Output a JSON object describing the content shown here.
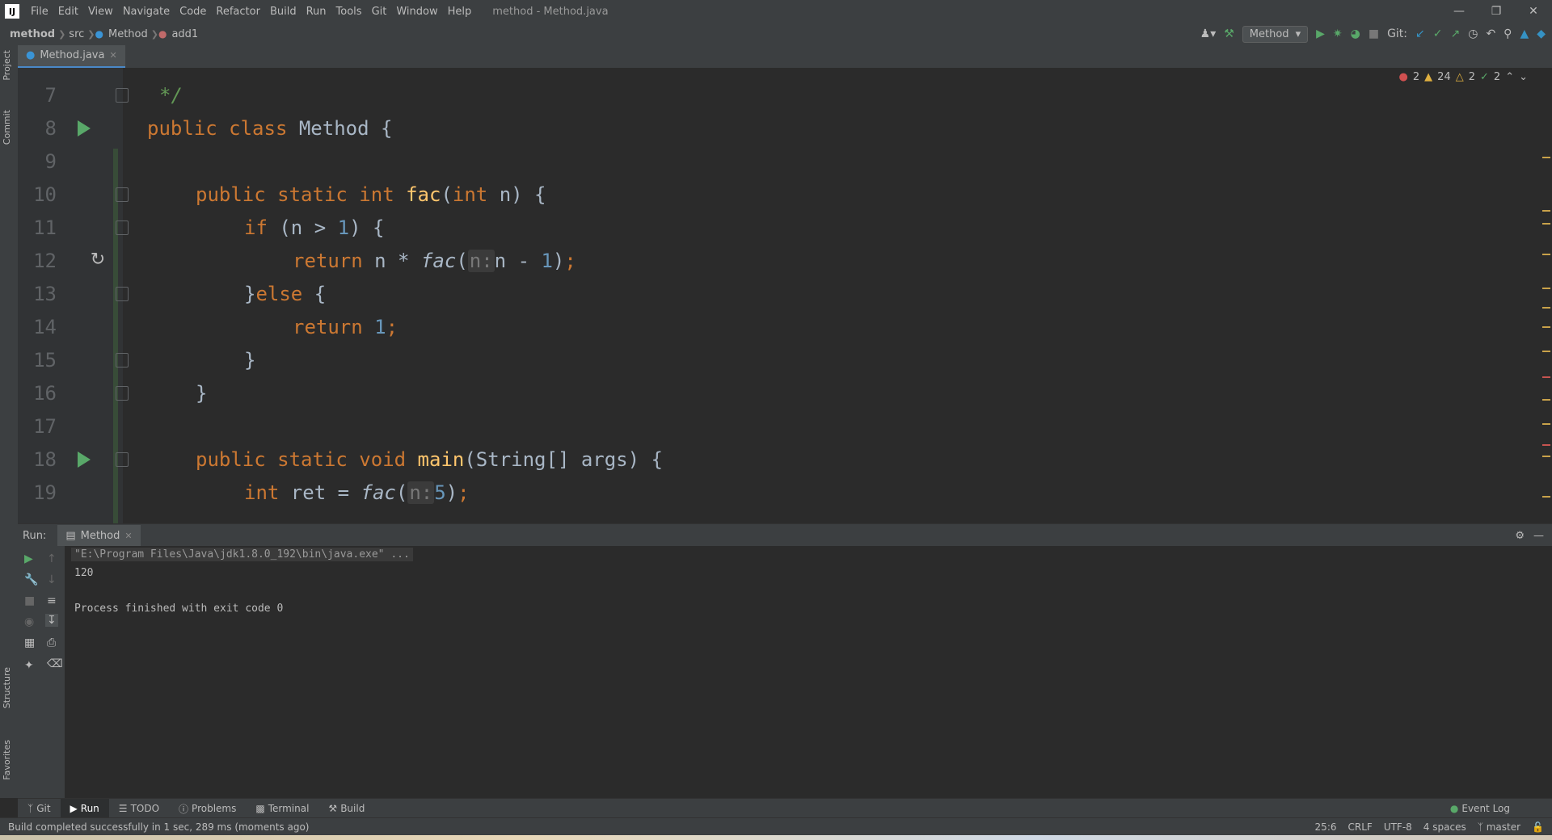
{
  "window": {
    "title": "method - Method.java",
    "menu": [
      "File",
      "Edit",
      "View",
      "Navigate",
      "Code",
      "Refactor",
      "Build",
      "Run",
      "Tools",
      "Git",
      "Window",
      "Help"
    ]
  },
  "breadcrumb": {
    "project": "method",
    "folder": "src",
    "class": "Method",
    "member": "add1"
  },
  "toolbar": {
    "run_config": "Method",
    "git_label": "Git:"
  },
  "side_panels": {
    "project": "Project",
    "commit": "Commit",
    "structure": "Structure",
    "favorites": "Favorites"
  },
  "editor": {
    "tab": "Method.java",
    "inspections": {
      "errors": "2",
      "warnings": "24",
      "weak_warnings": "2",
      "ok": "2"
    },
    "lines": [
      {
        "n": "7",
        "code": "*/"
      },
      {
        "n": "8",
        "code": "public class Method {"
      },
      {
        "n": "9",
        "code": ""
      },
      {
        "n": "10",
        "code": "public static int fac(int n) {"
      },
      {
        "n": "11",
        "code": "if (n > 1) {"
      },
      {
        "n": "12",
        "code": "return n * fac(n:n - 1);"
      },
      {
        "n": "13",
        "code": "}else {"
      },
      {
        "n": "14",
        "code": "return 1;"
      },
      {
        "n": "15",
        "code": "}"
      },
      {
        "n": "16",
        "code": "}"
      },
      {
        "n": "17",
        "code": ""
      },
      {
        "n": "18",
        "code": "public static void main(String[] args) {"
      },
      {
        "n": "19",
        "code": "int ret = fac(n:5);"
      }
    ],
    "hint_label": "n:"
  },
  "run_panel": {
    "label": "Run:",
    "tab": "Method",
    "console": [
      "\"E:\\Program Files\\Java\\jdk1.8.0_192\\bin\\java.exe\" ...",
      "120",
      "",
      "Process finished with exit code 0"
    ]
  },
  "tool_windows": [
    "Git",
    "Run",
    "TODO",
    "Problems",
    "Terminal",
    "Build"
  ],
  "event_log": "Event Log",
  "status": {
    "message": "Build completed successfully in 1 sec, 289 ms (moments ago)",
    "position": "25:6",
    "line_sep": "CRLF",
    "encoding": "UTF-8",
    "indent": "4 spaces",
    "branch": "master"
  }
}
